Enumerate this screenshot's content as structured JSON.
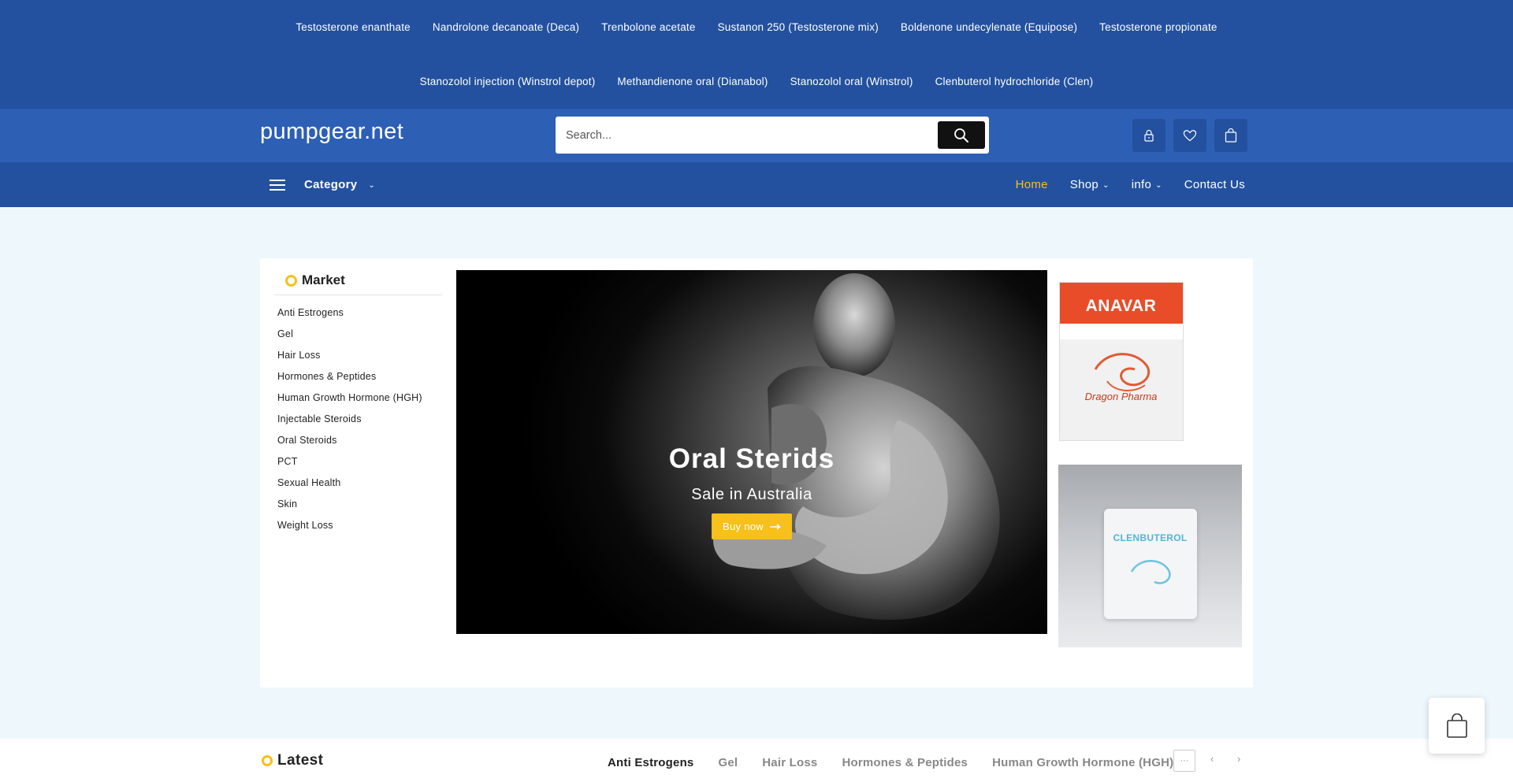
{
  "topbar": {
    "row1": [
      "Testosterone enanthate",
      "Nandrolone decanoate (Deca)",
      "Trenbolone acetate",
      "Sustanon 250 (Testosterone mix)",
      "Boldenone undecylenate (Equipose)",
      "Testosterone propionate"
    ],
    "row2": [
      "Stanozolol injection (Winstrol depot)",
      "Methandienone oral (Dianabol)",
      "Stanozolol oral (Winstrol)",
      "Clenbuterol hydrochloride (Clen)"
    ]
  },
  "header": {
    "brand": "pumpgear.net",
    "search_placeholder": "Search...",
    "icons": [
      "lock-icon",
      "heart-icon",
      "bag-icon"
    ]
  },
  "nav": {
    "category_label": "Category",
    "links": [
      {
        "label": "Home",
        "active": true,
        "dropdown": false
      },
      {
        "label": "Shop",
        "active": false,
        "dropdown": true
      },
      {
        "label": "info",
        "active": false,
        "dropdown": true
      },
      {
        "label": "Contact Us",
        "active": false,
        "dropdown": false
      }
    ]
  },
  "market": {
    "title": "Market",
    "items": [
      "Anti Estrogens",
      "Gel",
      "Hair Loss",
      "Hormones & Peptides",
      "Human Growth Hormone (HGH)",
      "Injectable Steroids",
      "Oral Steroids",
      "PCT",
      "Sexual Health",
      "Skin",
      "Weight Loss"
    ]
  },
  "banner": {
    "title": "Oral Sterids",
    "subtitle": "Sale in Australia",
    "button_label": "Buy now"
  },
  "side_products": {
    "product1_name": "ANAVAR",
    "product1_brand": "Dragon Pharma",
    "product2_name": "CLENBUTEROL"
  },
  "latest": {
    "title": "Latest",
    "tabs": [
      {
        "label": "Anti Estrogens",
        "active": true
      },
      {
        "label": "Gel",
        "active": false
      },
      {
        "label": "Hair Loss",
        "active": false
      },
      {
        "label": "Hormones & Peptides",
        "active": false
      },
      {
        "label": "Human Growth Hormone (HGH)",
        "active": false
      }
    ],
    "more_label": "···"
  },
  "colors": {
    "topbar": "#23519f",
    "header": "#2d5fb5",
    "accent": "#f7c01a",
    "page_bg": "#eef7fc"
  }
}
